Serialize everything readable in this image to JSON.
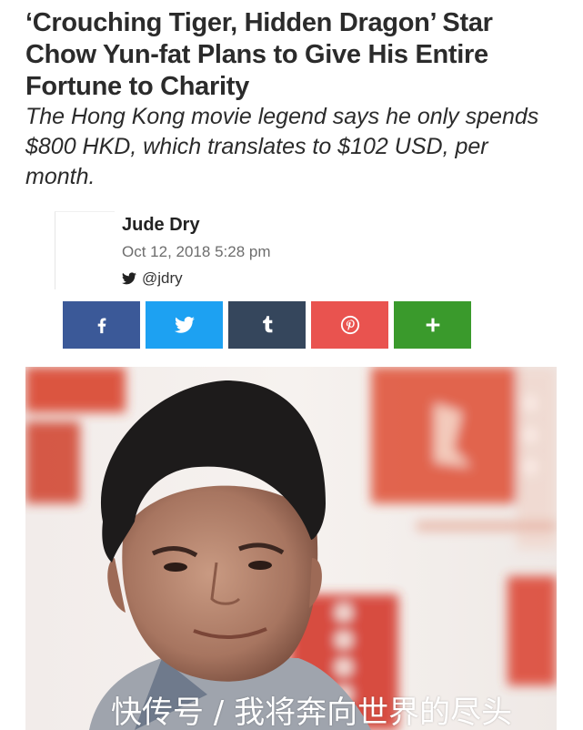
{
  "article": {
    "headline": "‘Crouching Tiger, Hidden Dragon’ Star Chow Yun-fat Plans to Give His Entire Fortune to Charity",
    "subheadline": "The Hong Kong movie legend says he only spends $800 HKD, which translates to $102 USD, per month."
  },
  "author": {
    "name": "Jude Dry",
    "date": "Oct 12, 2018 5:28 pm",
    "twitter_handle": "@jdry"
  },
  "share_buttons": [
    {
      "name": "facebook",
      "icon": "facebook-icon",
      "color": "#3b5998"
    },
    {
      "name": "twitter",
      "icon": "twitter-icon",
      "color": "#1da1f2"
    },
    {
      "name": "tumblr",
      "icon": "tumblr-icon",
      "color": "#35465c"
    },
    {
      "name": "pinterest",
      "icon": "pinterest-icon",
      "color": "#e9534f"
    },
    {
      "name": "more",
      "icon": "plus-icon",
      "color": "#3a9a2c"
    }
  ],
  "watermark": "快传号 / 我将奔向世界的尽头"
}
